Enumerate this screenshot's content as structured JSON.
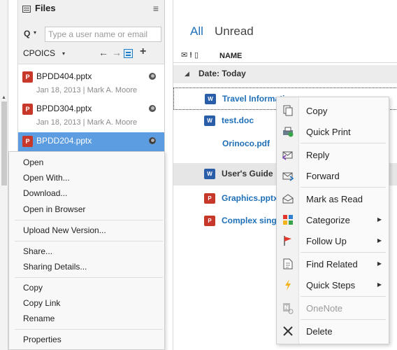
{
  "files_panel": {
    "title": "Files",
    "search_placeholder": "Type a user name or email",
    "scope_label": "CPOICS",
    "files": [
      {
        "name": "BPDD404.pptx",
        "meta": "Jan 18, 2013  |  Mark A. Moore"
      },
      {
        "name": "BPDD304.pptx",
        "meta": "Jan 18, 2013  |  Mark A. Moore"
      },
      {
        "name": "BPDD204.pptx",
        "meta": ""
      }
    ]
  },
  "file_context_menu": {
    "items": [
      "Open",
      "Open With...",
      "Download...",
      "Open in Browser",
      "Upload New Version...",
      "Share...",
      "Sharing Details...",
      "Copy",
      "Copy Link",
      "Rename",
      "Properties"
    ]
  },
  "mail": {
    "tab_all": "All",
    "tab_unread": "Unread",
    "column_name": "NAME",
    "group_label": "Date: Today",
    "rows": [
      {
        "title": "Travel Information"
      },
      {
        "title": "test.doc"
      },
      {
        "title": "Orinoco.pdf"
      },
      {
        "title": "User's Guide"
      },
      {
        "title": "Graphics.pptx"
      },
      {
        "title": "Complex single"
      }
    ]
  },
  "mail_context_menu": {
    "items": [
      {
        "label": "Copy",
        "icon": "copy-icon"
      },
      {
        "label": "Quick Print",
        "icon": "printer-icon"
      },
      {
        "label": "Reply",
        "icon": "reply-icon"
      },
      {
        "label": "Forward",
        "icon": "forward-icon"
      },
      {
        "label": "Mark as Read",
        "icon": "envelope-open-icon"
      },
      {
        "label": "Categorize",
        "icon": "categorize-icon"
      },
      {
        "label": "Follow Up",
        "icon": "flag-icon"
      },
      {
        "label": "Find Related",
        "icon": "find-related-icon"
      },
      {
        "label": "Quick Steps",
        "icon": "lightning-icon"
      },
      {
        "label": "OneNote",
        "icon": "onenote-icon"
      },
      {
        "label": "Delete",
        "icon": "delete-icon"
      }
    ]
  },
  "colors": {
    "accent": "#1e6fb8",
    "selection": "#5c9ce0",
    "ppt_red": "#c8382a",
    "word_blue": "#2a5ea8"
  }
}
